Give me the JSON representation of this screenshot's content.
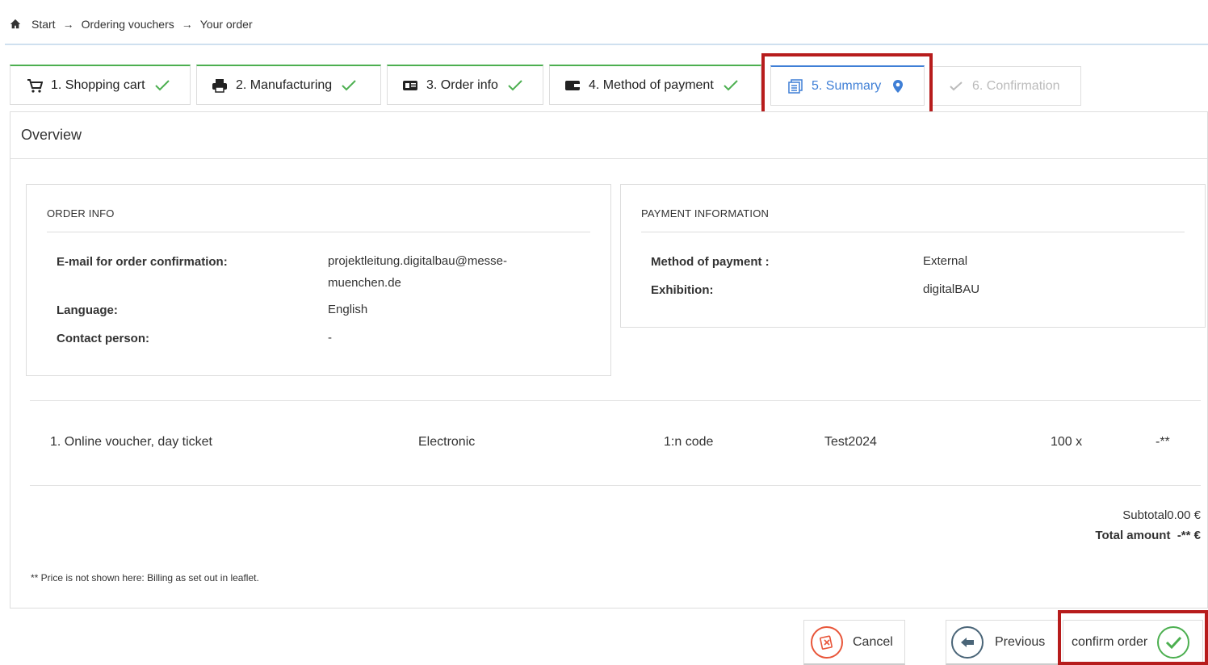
{
  "breadcrumb": {
    "items": [
      "Start",
      "Ordering vouchers",
      "Your order"
    ],
    "separator": "→"
  },
  "steps": [
    {
      "label": "1. Shopping cart",
      "icon": "shopping-cart-icon",
      "status": "done"
    },
    {
      "label": "2. Manufacturing",
      "icon": "printer-icon",
      "status": "done"
    },
    {
      "label": "3. Order info",
      "icon": "id-card-icon",
      "status": "done"
    },
    {
      "label": "4. Method of payment",
      "icon": "wallet-icon",
      "status": "done"
    },
    {
      "label": "5. Summary",
      "icon": "summary-icon",
      "status": "active"
    },
    {
      "label": "6. Confirmation",
      "icon": "check-icon",
      "status": "disabled"
    }
  ],
  "overview": {
    "title": "Overview",
    "order_info": {
      "title": "ORDER INFO",
      "fields": [
        {
          "label": "E-mail for order confirmation:",
          "value_line1": "projektleitung.digitalbau@messe-",
          "value_line2": "muenchen.de"
        },
        {
          "label": "Language:",
          "value": "English"
        },
        {
          "label": "Contact person:",
          "value": "-"
        }
      ]
    },
    "payment_info": {
      "title": "PAYMENT INFORMATION",
      "fields": [
        {
          "label": "Method of payment :",
          "value": "External"
        },
        {
          "label": "Exhibition:",
          "value": "digitalBAU"
        }
      ]
    },
    "order_line": {
      "item": "1. Online voucher, day ticket",
      "type": "Electronic",
      "code": "1:n code",
      "name": "Test2024",
      "quantity": "100 x",
      "price": "-**"
    },
    "subtotal_label": "Subtotal",
    "subtotal_value": "0.00 €",
    "total_label": "Total amount",
    "total_value": "-** €",
    "note": "** Price is not shown here: Billing as set out in leaflet."
  },
  "footer": {
    "cancel_label": "Cancel",
    "previous_label": "Previous",
    "confirm_label": "confirm order"
  },
  "colors": {
    "done_green": "#4caf50",
    "active_blue": "#3f7fd6",
    "highlight_red": "#b71c1c",
    "cancel_orange": "#e8563a"
  }
}
